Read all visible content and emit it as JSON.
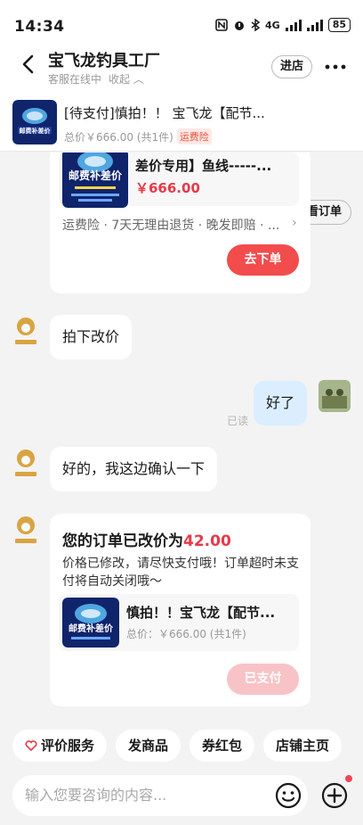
{
  "status_bar": {
    "time": "14:34",
    "network": "4G",
    "battery": "85"
  },
  "header": {
    "title": "宝飞龙钓具工厂",
    "status": "客服在线中",
    "collapse": "收起",
    "enter_store": "进店"
  },
  "pinned_order": {
    "title": "[待支付]慎拍！！ 宝飞龙【配节...",
    "total": "总价￥666.00 (共1件)",
    "tag": "运费险",
    "view_button": "查看订单"
  },
  "order_card": {
    "product_name": "差价专用】鱼线-----...",
    "price": "￥666.00",
    "services": "运费险 · 7天无理由退货 · 晚发即赔 · ...",
    "button": "去下单"
  },
  "messages": [
    {
      "from": "shop",
      "text": "拍下改价"
    },
    {
      "from": "me",
      "text": "好了",
      "status": "已读"
    },
    {
      "from": "shop",
      "text": "好的，我这边确认一下"
    }
  ],
  "price_change_card": {
    "heading": "您的订单已改价为",
    "amount": "42.00",
    "message": "价格已修改，请尽快支付哦！订单超时未支付将自动关闭哦～",
    "product_name": "慎拍！！宝飞龙【配节...",
    "product_meta": "总价：￥666.00 (共1件)",
    "button": "已支付"
  },
  "quick_actions": [
    "评价服务",
    "发商品",
    "券红包",
    "店铺主页"
  ],
  "input": {
    "placeholder": "输入您要咨询的内容..."
  },
  "product_image_text": "邮费补差价",
  "colors": {
    "accent_red": "#f24c4c",
    "price_red": "#e8394a",
    "my_bubble": "#dbeeff"
  }
}
